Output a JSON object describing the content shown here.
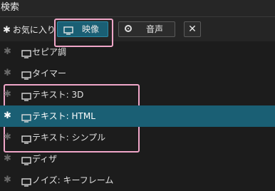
{
  "search": {
    "label": "検索"
  },
  "toolbar": {
    "favorites_label": "お気に入り",
    "video_label": "映像",
    "audio_label": "音声",
    "clear_label": "✕"
  },
  "effects": [
    {
      "name": "セピア調",
      "selected": false
    },
    {
      "name": "タイマー",
      "selected": false
    },
    {
      "name": "テキスト: 3D",
      "selected": false
    },
    {
      "name": "テキスト: HTML",
      "selected": true
    },
    {
      "name": "テキスト: シンプル",
      "selected": false
    },
    {
      "name": "ディザ",
      "selected": false
    },
    {
      "name": "ノイズ: キーフレーム",
      "selected": false
    }
  ],
  "colors": {
    "accent": "#1a5f74",
    "highlight": "#f0a6c8",
    "background": "#1c1c1c"
  },
  "icons": {
    "favorite": "star-icon",
    "video": "monitor-icon",
    "audio": "radio-icon",
    "clear": "close-icon"
  }
}
